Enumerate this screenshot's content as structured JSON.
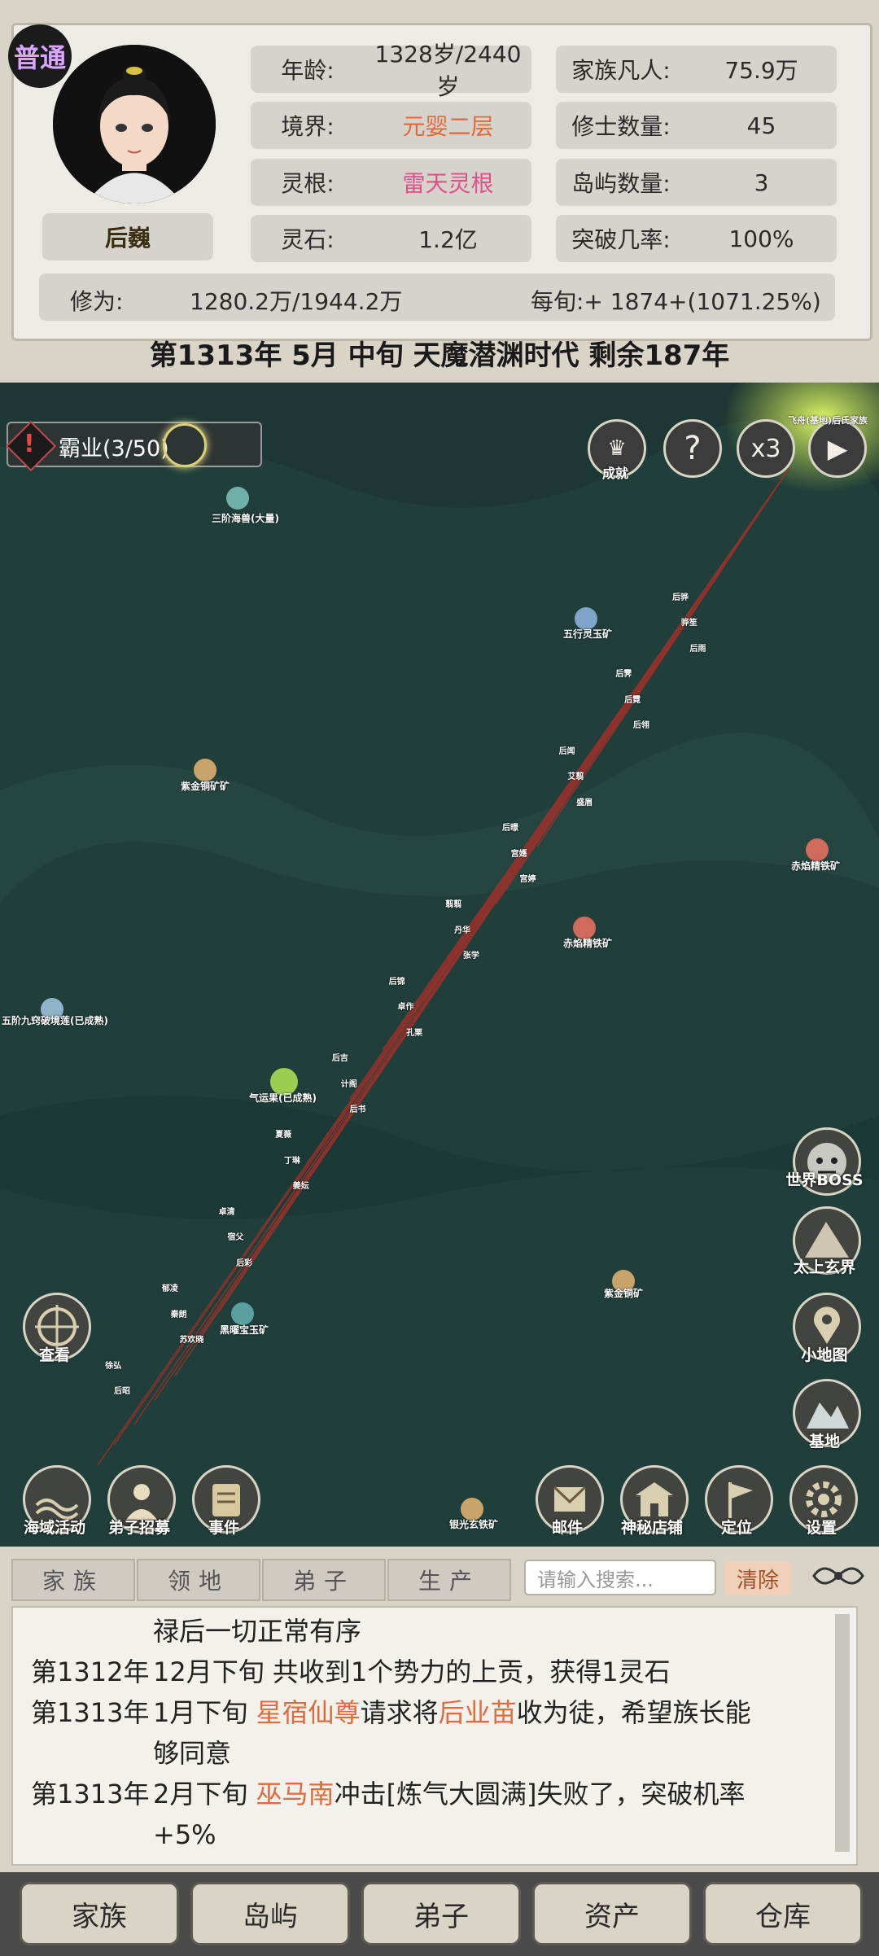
{
  "header": {
    "badge": "普通",
    "name": "后巍",
    "stats_left": [
      {
        "label": "年龄:",
        "value": "1328岁/2440岁",
        "style": "normal"
      },
      {
        "label": "境界:",
        "value": "元婴二层",
        "style": "red"
      },
      {
        "label": "灵根:",
        "value": "雷天灵根",
        "style": "pink"
      },
      {
        "label": "灵石:",
        "value": "1.2亿",
        "style": "normal"
      }
    ],
    "stats_right": [
      {
        "label": "家族凡人:",
        "value": "75.9万"
      },
      {
        "label": "修士数量:",
        "value": "45"
      },
      {
        "label": "岛屿数量:",
        "value": "3"
      },
      {
        "label": "突破几率:",
        "value": "100%"
      }
    ],
    "cultivation_label": "修为:",
    "cultivation_value": "1280.2万/1944.2万",
    "per_tick": "每旬:+ 1874+(1071.25%)",
    "date_line": "第1313年 5月 中旬  天魔潜渊时代 剩余187年"
  },
  "map": {
    "quest": "霸业(3/50)",
    "top_buttons": [
      {
        "icon": "achievement-icon",
        "label": "成就"
      },
      {
        "icon": "help-icon",
        "label": "?"
      },
      {
        "icon": "speed-icon",
        "label": "x3"
      },
      {
        "icon": "play-icon",
        "label": "▶"
      }
    ],
    "corner_tag": "飞舟(基地)后氏家族",
    "nodes": [
      {
        "label": "三阶海兽(大量)",
        "color": "#6fb0a8"
      },
      {
        "label": "五行灵玉矿",
        "color": "#7fa3c9"
      },
      {
        "label": "紫金铜矿矿",
        "color": "#c9a46a"
      },
      {
        "label": "赤焰精铁矿",
        "color": "#d06a5a"
      },
      {
        "label": "赤焰精铁矿",
        "color": "#d06a5a"
      },
      {
        "label": "五阶九窍破境莲(已成熟)",
        "color": "#8fb3c9"
      },
      {
        "label": "气运果(已成熟)",
        "color": "#9acd50"
      },
      {
        "label": "紫金铜矿",
        "color": "#c9a46a"
      },
      {
        "label": "黑曜宝玉矿",
        "color": "#5aa0a0"
      },
      {
        "label": "银光玄铁矿",
        "color": "#c9a46a"
      }
    ],
    "route_names": [
      "后骅",
      "骅笙",
      "后雨",
      "后霁",
      "后霓",
      "后翎",
      "后闻",
      "艾翦",
      "盛眉",
      "后暻",
      "宫嫕",
      "宫婷",
      "翦翦",
      "丹华",
      "张学",
      "后锦",
      "卓作",
      "孔栗",
      "后吉",
      "计阁",
      "后书",
      "夏薇",
      "丁琳",
      "姜妘",
      "卓清",
      "宿父",
      "后彩",
      "郁凌",
      "秦朗",
      "苏欢晓",
      "徐弘",
      "后昭"
    ],
    "side_buttons": [
      {
        "icon": "world-boss-icon",
        "label": "世界BOSS"
      },
      {
        "icon": "mountain-icon",
        "label": "太上玄界"
      },
      {
        "icon": "map-pin-icon",
        "label": "小地图"
      },
      {
        "icon": "base-icon",
        "label": "基地"
      }
    ],
    "view_button": "查看",
    "bottom_left_buttons": [
      {
        "icon": "sea-icon",
        "label": "海域活动"
      },
      {
        "icon": "recruit-icon",
        "label": "弟子招募"
      },
      {
        "icon": "scroll-icon",
        "label": "事件"
      }
    ],
    "bottom_right_buttons": [
      {
        "icon": "mail-icon",
        "label": "邮件"
      },
      {
        "icon": "shop-icon",
        "label": "神秘店铺"
      },
      {
        "icon": "flag-icon",
        "label": "定位"
      },
      {
        "icon": "gear-icon",
        "label": "设置"
      }
    ]
  },
  "log_panel": {
    "tabs": [
      "家族",
      "领地",
      "弟子",
      "生产"
    ],
    "search_placeholder": "请输入搜索...",
    "clear_label": "清除",
    "lines": [
      {
        "prefix": "",
        "parts": [
          {
            "t": "禄后一切正常有序",
            "h": false
          }
        ]
      },
      {
        "prefix": "第1312年",
        "parts": [
          {
            "t": "12月下旬 共收到1个势力的上贡，获得1灵石",
            "h": false
          }
        ]
      },
      {
        "prefix": "第1313年",
        "parts": [
          {
            "t": "1月下旬 ",
            "h": false
          },
          {
            "t": "星宿仙尊",
            "h": true
          },
          {
            "t": "请求将",
            "h": false
          },
          {
            "t": "后业苗",
            "h": true
          },
          {
            "t": "收为徒，希望族长能",
            "h": false
          }
        ]
      },
      {
        "prefix": "",
        "parts": [
          {
            "t": "够同意",
            "h": false
          }
        ]
      },
      {
        "prefix": "第1313年",
        "parts": [
          {
            "t": "2月下旬 ",
            "h": false
          },
          {
            "t": "巫马南",
            "h": true
          },
          {
            "t": "冲击[炼气大圆满]失败了，突破机率",
            "h": false
          }
        ]
      },
      {
        "prefix": "",
        "parts": [
          {
            "t": "+5%",
            "h": false
          }
        ]
      }
    ]
  },
  "nav": [
    "家族",
    "岛屿",
    "弟子",
    "资产",
    "仓库"
  ]
}
